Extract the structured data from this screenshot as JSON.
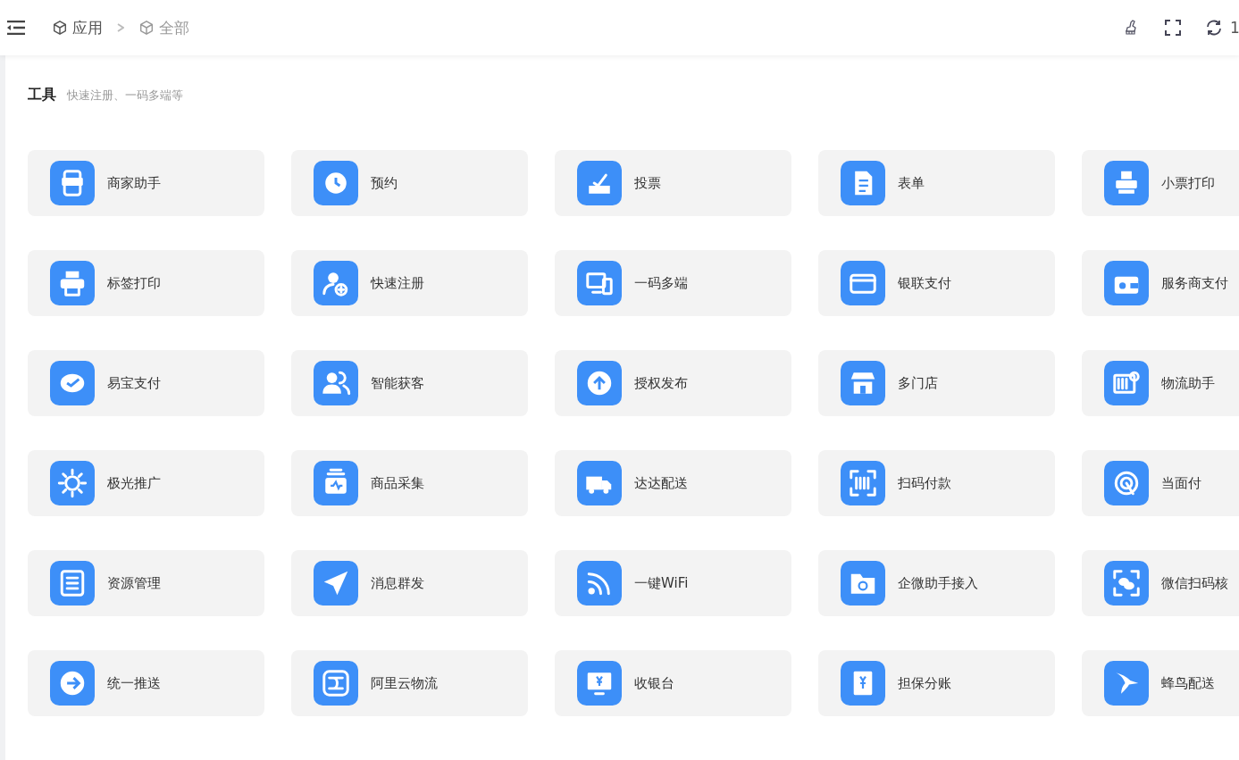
{
  "breadcrumb": [
    {
      "label": "应用",
      "selected": false
    },
    {
      "label": "全部",
      "selected": true
    }
  ],
  "toolbar_text": "1",
  "section": {
    "title": "工具",
    "subtitle": "快速注册、一码多端等"
  },
  "apps": [
    {
      "label": "商家助手"
    },
    {
      "label": "预约"
    },
    {
      "label": "投票"
    },
    {
      "label": "表单"
    },
    {
      "label": "小票打印"
    },
    {
      "label": "标签打印"
    },
    {
      "label": "快速注册"
    },
    {
      "label": "一码多端"
    },
    {
      "label": "银联支付"
    },
    {
      "label": "服务商支付"
    },
    {
      "label": "易宝支付"
    },
    {
      "label": "智能获客"
    },
    {
      "label": "授权发布"
    },
    {
      "label": "多门店"
    },
    {
      "label": "物流助手"
    },
    {
      "label": "极光推广"
    },
    {
      "label": "商品采集"
    },
    {
      "label": "达达配送"
    },
    {
      "label": "扫码付款"
    },
    {
      "label": "当面付"
    },
    {
      "label": "资源管理"
    },
    {
      "label": "消息群发"
    },
    {
      "label": "一键WiFi"
    },
    {
      "label": "企微助手接入"
    },
    {
      "label": "微信扫码核"
    },
    {
      "label": "统一推送"
    },
    {
      "label": "阿里云物流"
    },
    {
      "label": "收银台"
    },
    {
      "label": "担保分账"
    },
    {
      "label": "蜂鸟配送"
    }
  ]
}
